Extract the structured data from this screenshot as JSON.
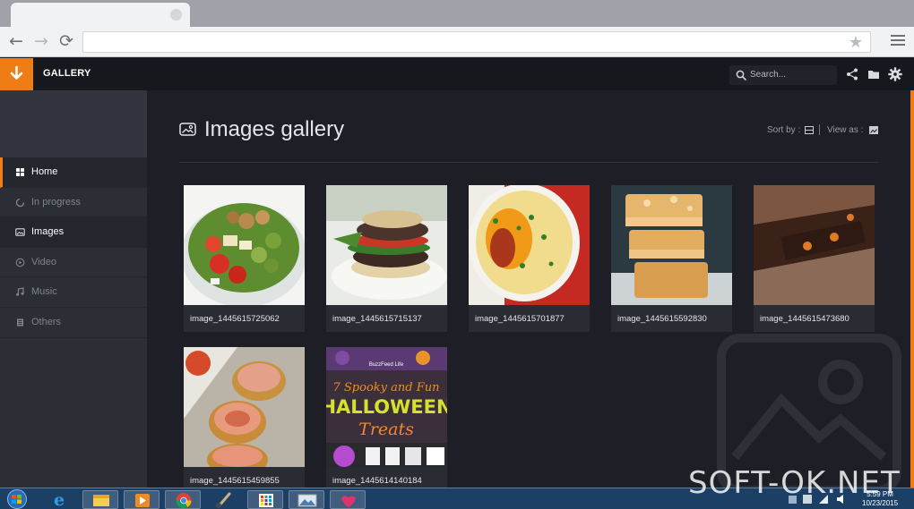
{
  "browser": {
    "back_icon": "back-arrow-icon",
    "forward_icon": "forward-arrow-icon",
    "reload_icon": "reload-icon",
    "address_value": "",
    "bookmark_icon": "star-icon",
    "menu_icon": "hamburger-menu-icon"
  },
  "header": {
    "title": "GALLERY",
    "download_icon": "download-arrow-icon",
    "search_placeholder": "Search...",
    "actions": [
      "share-icon",
      "folder-icon",
      "gear-icon"
    ],
    "accent": "#ef7d16"
  },
  "sidebar": {
    "items": [
      {
        "label": "Home",
        "icon": "grid-icon",
        "active": true
      },
      {
        "label": "In progress",
        "icon": "progress-icon",
        "active": false
      },
      {
        "label": "Images",
        "icon": "image-icon",
        "active": false
      },
      {
        "label": "Video",
        "icon": "play-icon",
        "active": false
      },
      {
        "label": "Music",
        "icon": "music-note-icon",
        "active": false
      },
      {
        "label": "Others",
        "icon": "stack-icon",
        "active": false
      }
    ]
  },
  "main": {
    "title": "Images gallery",
    "sort_label": "Sort by :",
    "view_label": "View as :",
    "images": [
      {
        "name": "image_1445615725062",
        "subject": "salad bowl"
      },
      {
        "name": "image_1445615715137",
        "subject": "portobello burger"
      },
      {
        "name": "image_1445615701877",
        "subject": "potato soup with bacon"
      },
      {
        "name": "image_1445615592830",
        "subject": "crumble bars"
      },
      {
        "name": "image_1445615473680",
        "subject": "brownies"
      },
      {
        "name": "image_1445615459855",
        "subject": "apple rose tarts"
      },
      {
        "name": "image_1445614140184",
        "subject": "halloween treats poster"
      }
    ],
    "poster": {
      "brand": "BuzzFeed Life",
      "line1": "7 Spooky and Fun",
      "line2": "HALLOWEEN",
      "line3": "Treats"
    }
  },
  "taskbar": {
    "apps": [
      "start-orb-icon",
      "internet-explorer-icon",
      "file-explorer-icon",
      "media-player-icon",
      "chrome-icon",
      "paint-brush-icon",
      "app-grid-icon",
      "picture-viewer-icon",
      "heart-app-icon"
    ],
    "time": "5:59 PM",
    "date": "10/23/2015"
  },
  "watermark": "SOFT-OK.NET"
}
